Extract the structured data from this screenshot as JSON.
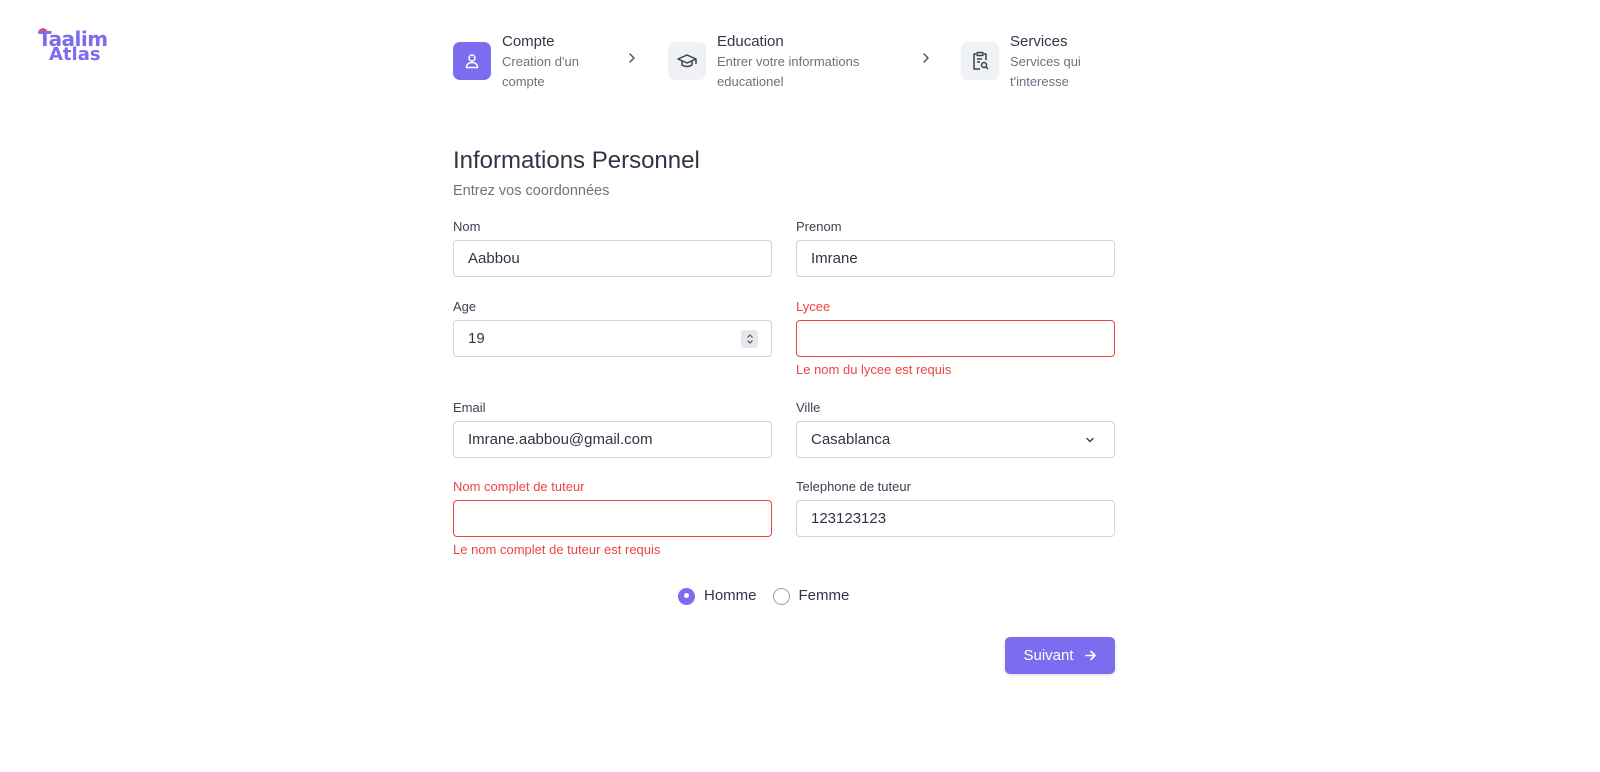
{
  "brand": {
    "line1": "Taalim",
    "line2": "Atlas",
    "color": "#7c6cf0"
  },
  "stepper": {
    "steps": [
      {
        "title": "Compte",
        "desc1": "Creation d'un",
        "desc2": "compte",
        "icon": "user-icon",
        "active": true
      },
      {
        "title": "Education",
        "desc1": "Entrer votre informations",
        "desc2": "educationel",
        "icon": "graduation-cap-icon",
        "active": false
      },
      {
        "title": "Services",
        "desc1": "Services qui",
        "desc2": "t'interesse",
        "icon": "clipboard-search-icon",
        "active": false
      }
    ]
  },
  "form": {
    "title": "Informations Personnel",
    "subtitle": "Entrez vos coordonnées",
    "nom": {
      "label": "Nom",
      "value": "Aabbou"
    },
    "prenom": {
      "label": "Prenom",
      "value": "Imrane"
    },
    "age": {
      "label": "Age",
      "value": "19"
    },
    "lycee": {
      "label": "Lycee",
      "value": "",
      "error": "Le nom du lycee est requis"
    },
    "email": {
      "label": "Email",
      "value": "Imrane.aabbou@gmail.com"
    },
    "ville": {
      "label": "Ville",
      "value": "Casablanca"
    },
    "tuteur_nom": {
      "label": "Nom complet de tuteur",
      "value": "",
      "error": "Le nom complet de tuteur est requis"
    },
    "tuteur_tel": {
      "label": "Telephone de tuteur",
      "value": "123123123"
    },
    "gender": {
      "options": [
        "Homme",
        "Femme"
      ],
      "selected": "Homme"
    },
    "next_label": "Suivant"
  },
  "colors": {
    "accent": "#7c6cf0",
    "error": "#ef4444"
  }
}
